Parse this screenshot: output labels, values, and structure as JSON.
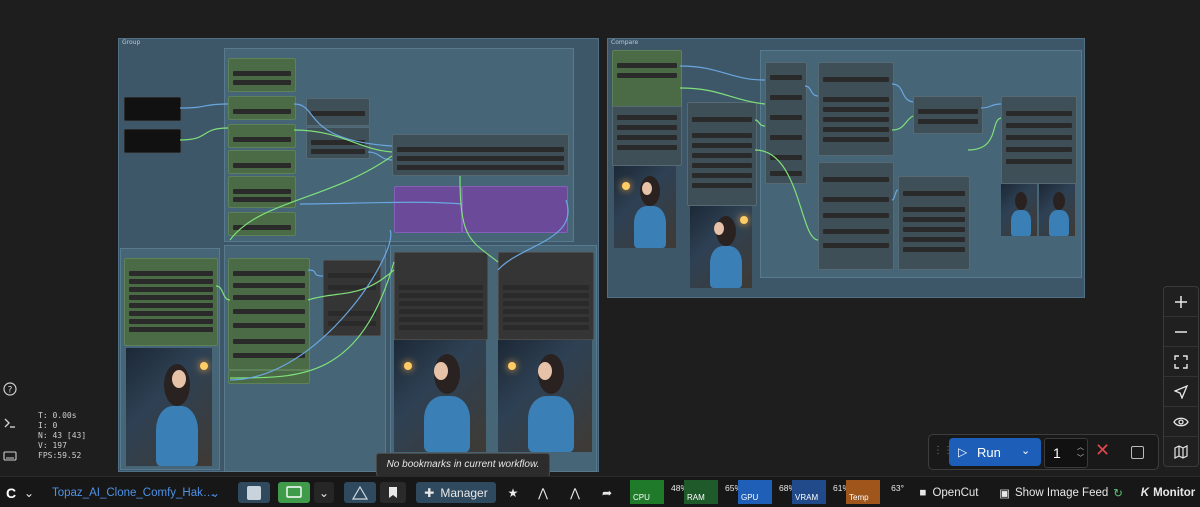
{
  "canvas": {
    "groups": {
      "left": "Group",
      "right": "Compare"
    }
  },
  "stats": {
    "t": "T: 0.00s",
    "i": "I: 0",
    "n": "N: 43 [43]",
    "v": "V: 197",
    "fps": "FPS:59.52"
  },
  "tooltip": "No bookmarks in current workflow.",
  "run_panel": {
    "run_label": "Run",
    "batch_count": "1"
  },
  "bottombar": {
    "logo": "C",
    "workflow_name": "Topaz_AI_Clone_Comfy_Hak…",
    "manager_label": "Manager",
    "resources": [
      {
        "label": "CPU",
        "value": "48%",
        "color": "#1f7a2a"
      },
      {
        "label": "RAM",
        "value": "65%",
        "color": "#1f5a2a"
      },
      {
        "label": "GPU",
        "value": "68%",
        "color": "#1f5fb8"
      },
      {
        "label": "VRAM",
        "value": "61%",
        "color": "#214a8a"
      },
      {
        "label": "Temp",
        "value": "63°",
        "color": "#a0561a"
      }
    ],
    "opencut_label": "OpenCut",
    "image_feed_label": "Show Image Feed",
    "monitor_label": "Monitor"
  },
  "icons": [
    "help-icon",
    "terminal-icon",
    "keyboard-icon",
    "zoom-in-icon",
    "zoom-out-icon",
    "fit-view-icon",
    "select-cursor-icon",
    "eye-icon",
    "map-icon",
    "play-icon",
    "chevron-down-icon",
    "close-icon",
    "stop-icon",
    "bookmark-icon",
    "puzzle-icon",
    "star-icon",
    "share-icon",
    "camera-icon",
    "image-icon"
  ]
}
